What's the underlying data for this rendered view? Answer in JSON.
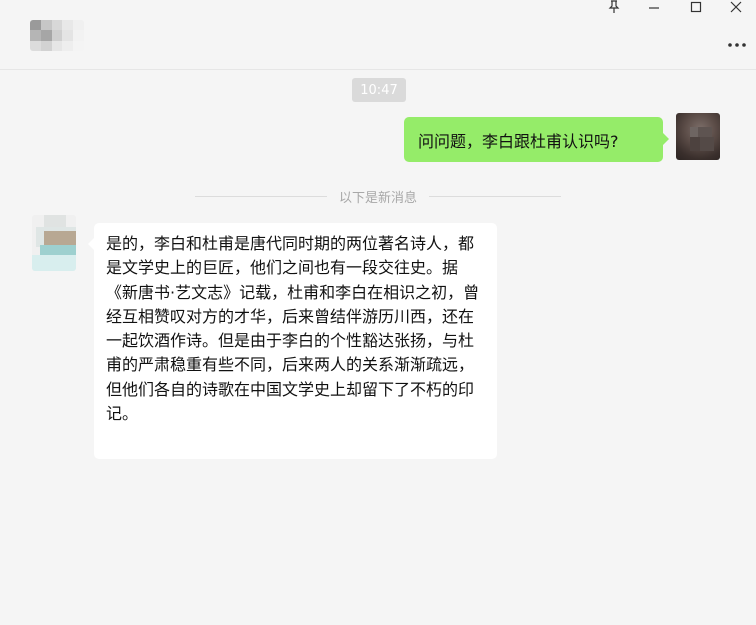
{
  "window": {
    "controls": {
      "pin_icon": "pin-icon",
      "minimize_icon": "minimize-icon",
      "maximize_icon": "maximize-icon",
      "close_icon": "close-icon",
      "more_icon": "more-icon",
      "pin_glyph": "⊥",
      "minimize_glyph": "—",
      "maximize_glyph": "☐",
      "close_glyph": "✕",
      "more_glyph": "···"
    }
  },
  "chat": {
    "timestamp": "10:47",
    "divider_text": "以下是新消息",
    "messages": [
      {
        "side": "outgoing",
        "text": "问问题，李白跟杜甫认识吗?"
      },
      {
        "side": "incoming",
        "text": "是的，李白和杜甫是唐代同时期的两位著名诗人，都是文学史上的巨匠，他们之间也有一段交往史。据《新唐书·艺文志》记载，杜甫和李白在相识之初，曾经互相赞叹对方的才华，后来曾结伴游历川西，还在一起饮酒作诗。但是由于李白的个性豁达张扬，与杜甫的严肃稳重有些不同，后来两人的关系渐渐疏远，但他们各自的诗歌在中国文学史上却留下了不朽的印记。"
      }
    ]
  },
  "colors": {
    "background": "#f5f5f5",
    "outgoing_bubble": "#95ec69",
    "incoming_bubble": "#ffffff",
    "timestamp_badge": "#dadada",
    "divider_text": "#a8a8a8"
  }
}
